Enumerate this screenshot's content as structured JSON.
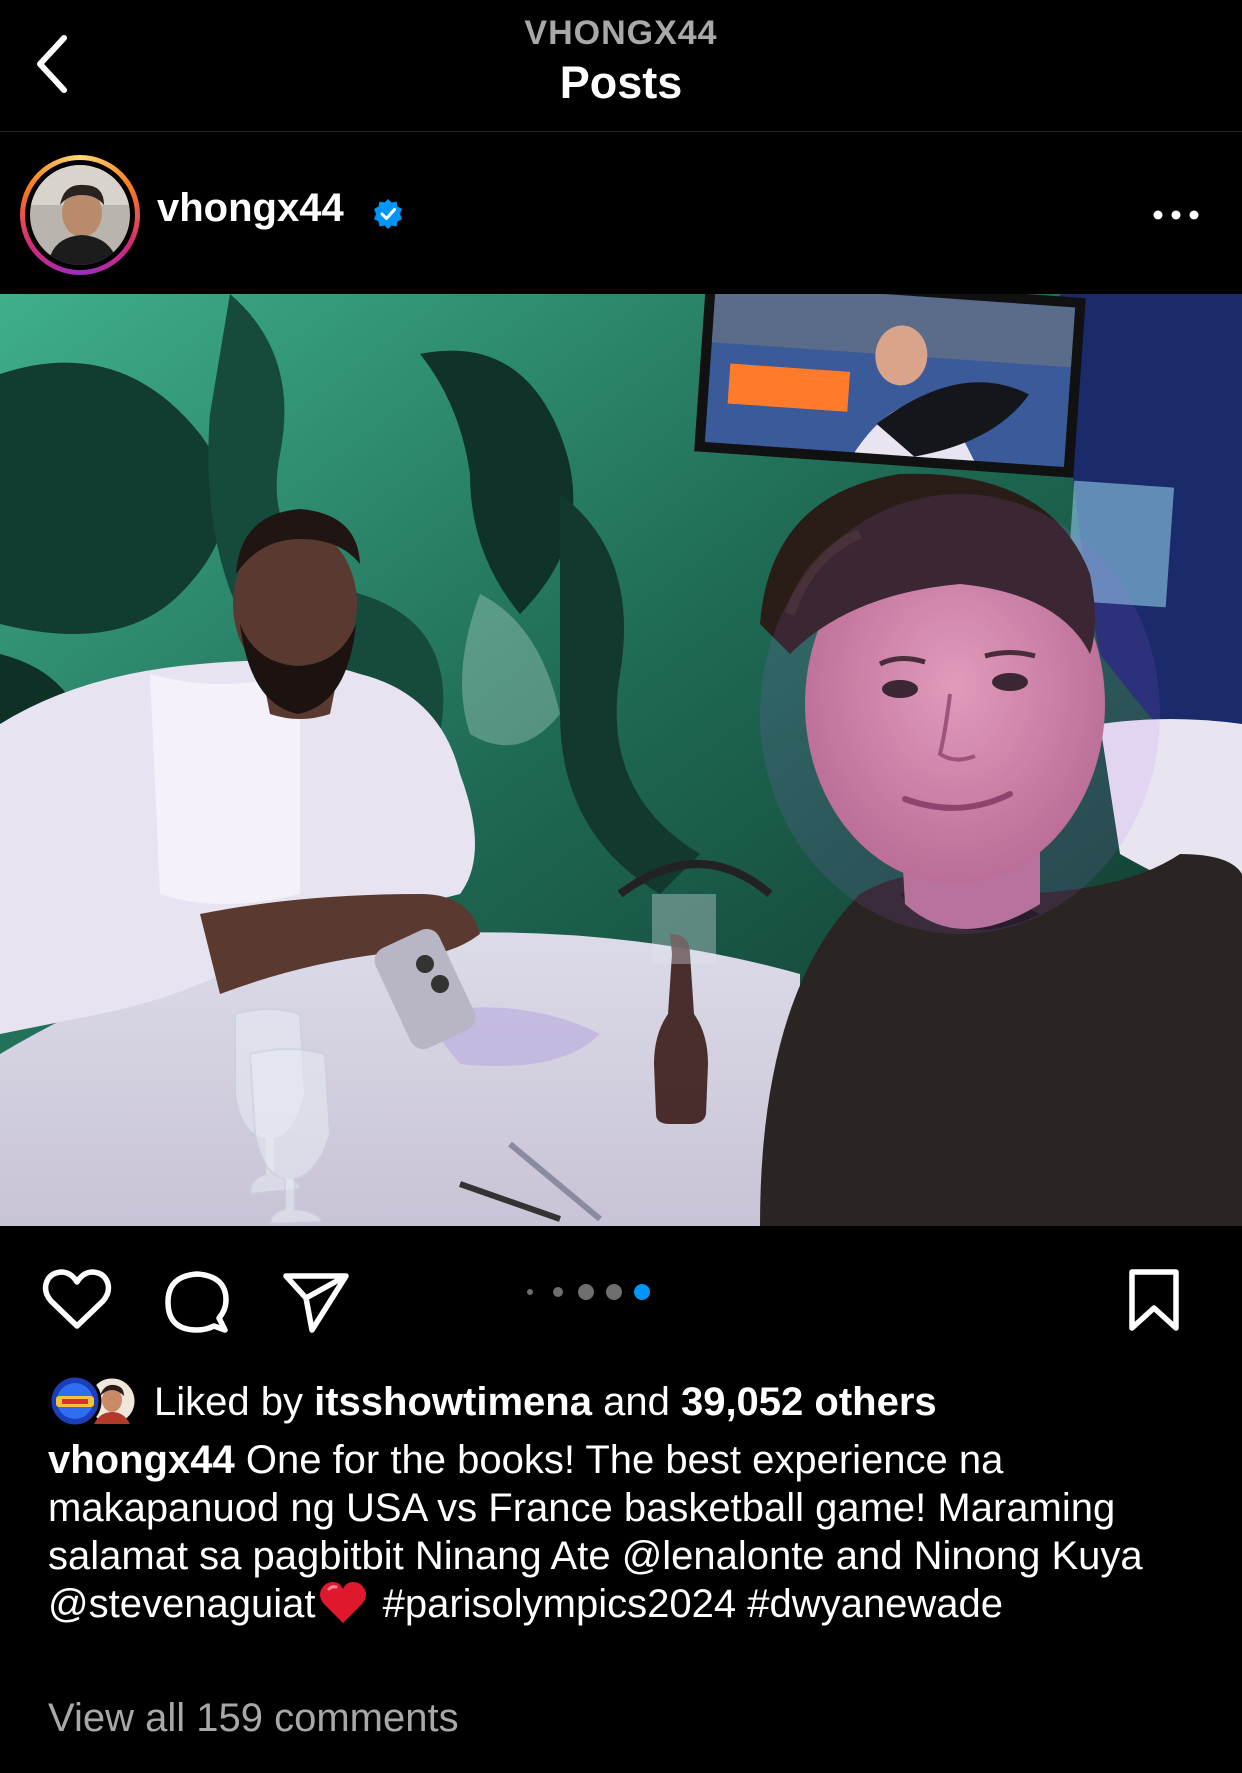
{
  "header": {
    "username_caps": "VHONGX44",
    "title": "Posts"
  },
  "post": {
    "username": "vhongx44",
    "verified": true,
    "likes": {
      "prefix": "Liked by",
      "liker": "itsshowtimena",
      "connector": "and",
      "count_text": "39,052 others"
    },
    "caption": {
      "username": "vhongx44",
      "text_before_emoji": "One for the books! The best experience na makapanuod ng USA vs France basketball game! Maraming salamat sa pagbitbit Ninang Ate @lenalonte and Ninong Kuya @stevenaguiat",
      "emoji": "red-heart",
      "text_after_emoji": "#parisolympics2024 #dwyanewade"
    },
    "view_comments": "View all 159 comments",
    "carousel": {
      "total": 5,
      "active_index": 4
    }
  },
  "icons": {
    "back": "chevron-left-icon",
    "verified": "verified-badge-icon",
    "more": "more-horizontal-icon",
    "like": "heart-outline-icon",
    "comment": "speech-bubble-icon",
    "share": "paper-plane-icon",
    "save": "bookmark-outline-icon"
  },
  "colors": {
    "background": "#000000",
    "text": "#ffffff",
    "muted": "#a8a8a8",
    "accent": "#0095f6",
    "divider": "#262626"
  }
}
